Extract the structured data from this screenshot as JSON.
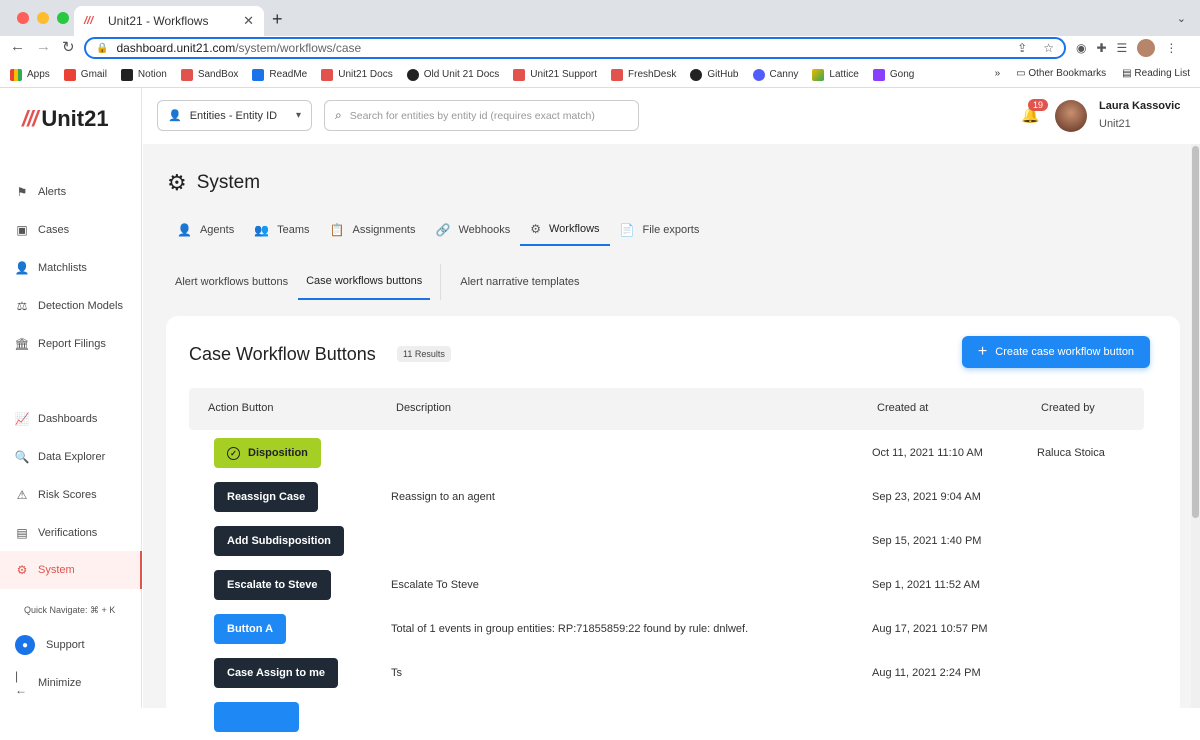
{
  "browser": {
    "tab_title": "Unit21 - Workflows",
    "url_host": "dashboard.unit21.com",
    "url_path": "/system/workflows/case",
    "bookmarks": [
      "Apps",
      "Gmail",
      "Notion",
      "SandBox",
      "ReadMe",
      "Unit21 Docs",
      "Old Unit 21 Docs",
      "Unit21 Support",
      "FreshDesk",
      "GitHub",
      "Canny",
      "Lattice",
      "Gong"
    ],
    "other_bookmarks": "Other Bookmarks",
    "reading_list": "Reading List"
  },
  "sidebar": {
    "logo": "Unit21",
    "items": [
      {
        "label": "Alerts",
        "icon": "flag-icon"
      },
      {
        "label": "Cases",
        "icon": "briefcase-icon"
      },
      {
        "label": "Matchlists",
        "icon": "user-plus-icon"
      },
      {
        "label": "Detection Models",
        "icon": "scale-icon"
      },
      {
        "label": "Report Filings",
        "icon": "bank-icon"
      },
      {
        "label": "Dashboards",
        "icon": "chart-icon"
      },
      {
        "label": "Data Explorer",
        "icon": "search-list-icon"
      },
      {
        "label": "Risk Scores",
        "icon": "warning-icon"
      },
      {
        "label": "Verifications",
        "icon": "id-card-icon"
      },
      {
        "label": "System",
        "icon": "gear-icon"
      }
    ],
    "quick_navigate": "Quick Navigate: ⌘ + K",
    "support": "Support",
    "minimize": "Minimize"
  },
  "topbar": {
    "entity_select": "Entities - Entity ID",
    "search_placeholder": "Search for entities by entity id (requires exact match)",
    "notification_count": "19",
    "user_name": "Laura Kassovic",
    "user_org": "Unit21"
  },
  "page": {
    "title": "System",
    "tabs": [
      "Agents",
      "Teams",
      "Assignments",
      "Webhooks",
      "Workflows",
      "File exports"
    ],
    "subtabs": [
      "Alert workflows buttons",
      "Case workflows buttons",
      "Alert narrative templates"
    ]
  },
  "card": {
    "title": "Case Workflow Buttons",
    "count": "11 Results",
    "create_label": "Create case workflow button",
    "columns": [
      "Action Button",
      "Description",
      "Created at",
      "Created by"
    ],
    "rows": [
      {
        "button": "Disposition",
        "color": "#a6cf26",
        "text_color": "#222222",
        "check": true,
        "description": "",
        "created_at": "Oct 11, 2021 11:10 AM",
        "created_by": "Raluca Stoica"
      },
      {
        "button": "Reassign Case",
        "color": "#1f2a36",
        "text_color": "#ffffff",
        "check": false,
        "description": "Reassign to an agent",
        "created_at": "Sep 23, 2021 9:04 AM",
        "created_by": ""
      },
      {
        "button": "Add Subdisposition",
        "color": "#1f2a36",
        "text_color": "#ffffff",
        "check": false,
        "description": "",
        "created_at": "Sep 15, 2021 1:40 PM",
        "created_by": ""
      },
      {
        "button": "Escalate to Steve",
        "color": "#1f2a36",
        "text_color": "#ffffff",
        "check": false,
        "description": "Escalate To Steve",
        "created_at": "Sep 1, 2021 11:52 AM",
        "created_by": ""
      },
      {
        "button": "Button A",
        "color": "#1e88f5",
        "text_color": "#ffffff",
        "check": false,
        "description": "Total of 1 events in group entities: RP:71855859:22 found by rule: dnlwef.",
        "created_at": "Aug 17, 2021 10:57 PM",
        "created_by": ""
      },
      {
        "button": "Case Assign to me",
        "color": "#1f2a36",
        "text_color": "#ffffff",
        "check": false,
        "description": "Ts",
        "created_at": "Aug 11, 2021 2:24 PM",
        "created_by": ""
      },
      {
        "button": "",
        "color": "#1e88f5",
        "text_color": "#ffffff",
        "check": false,
        "description": "",
        "created_at": "",
        "created_by": ""
      }
    ]
  }
}
